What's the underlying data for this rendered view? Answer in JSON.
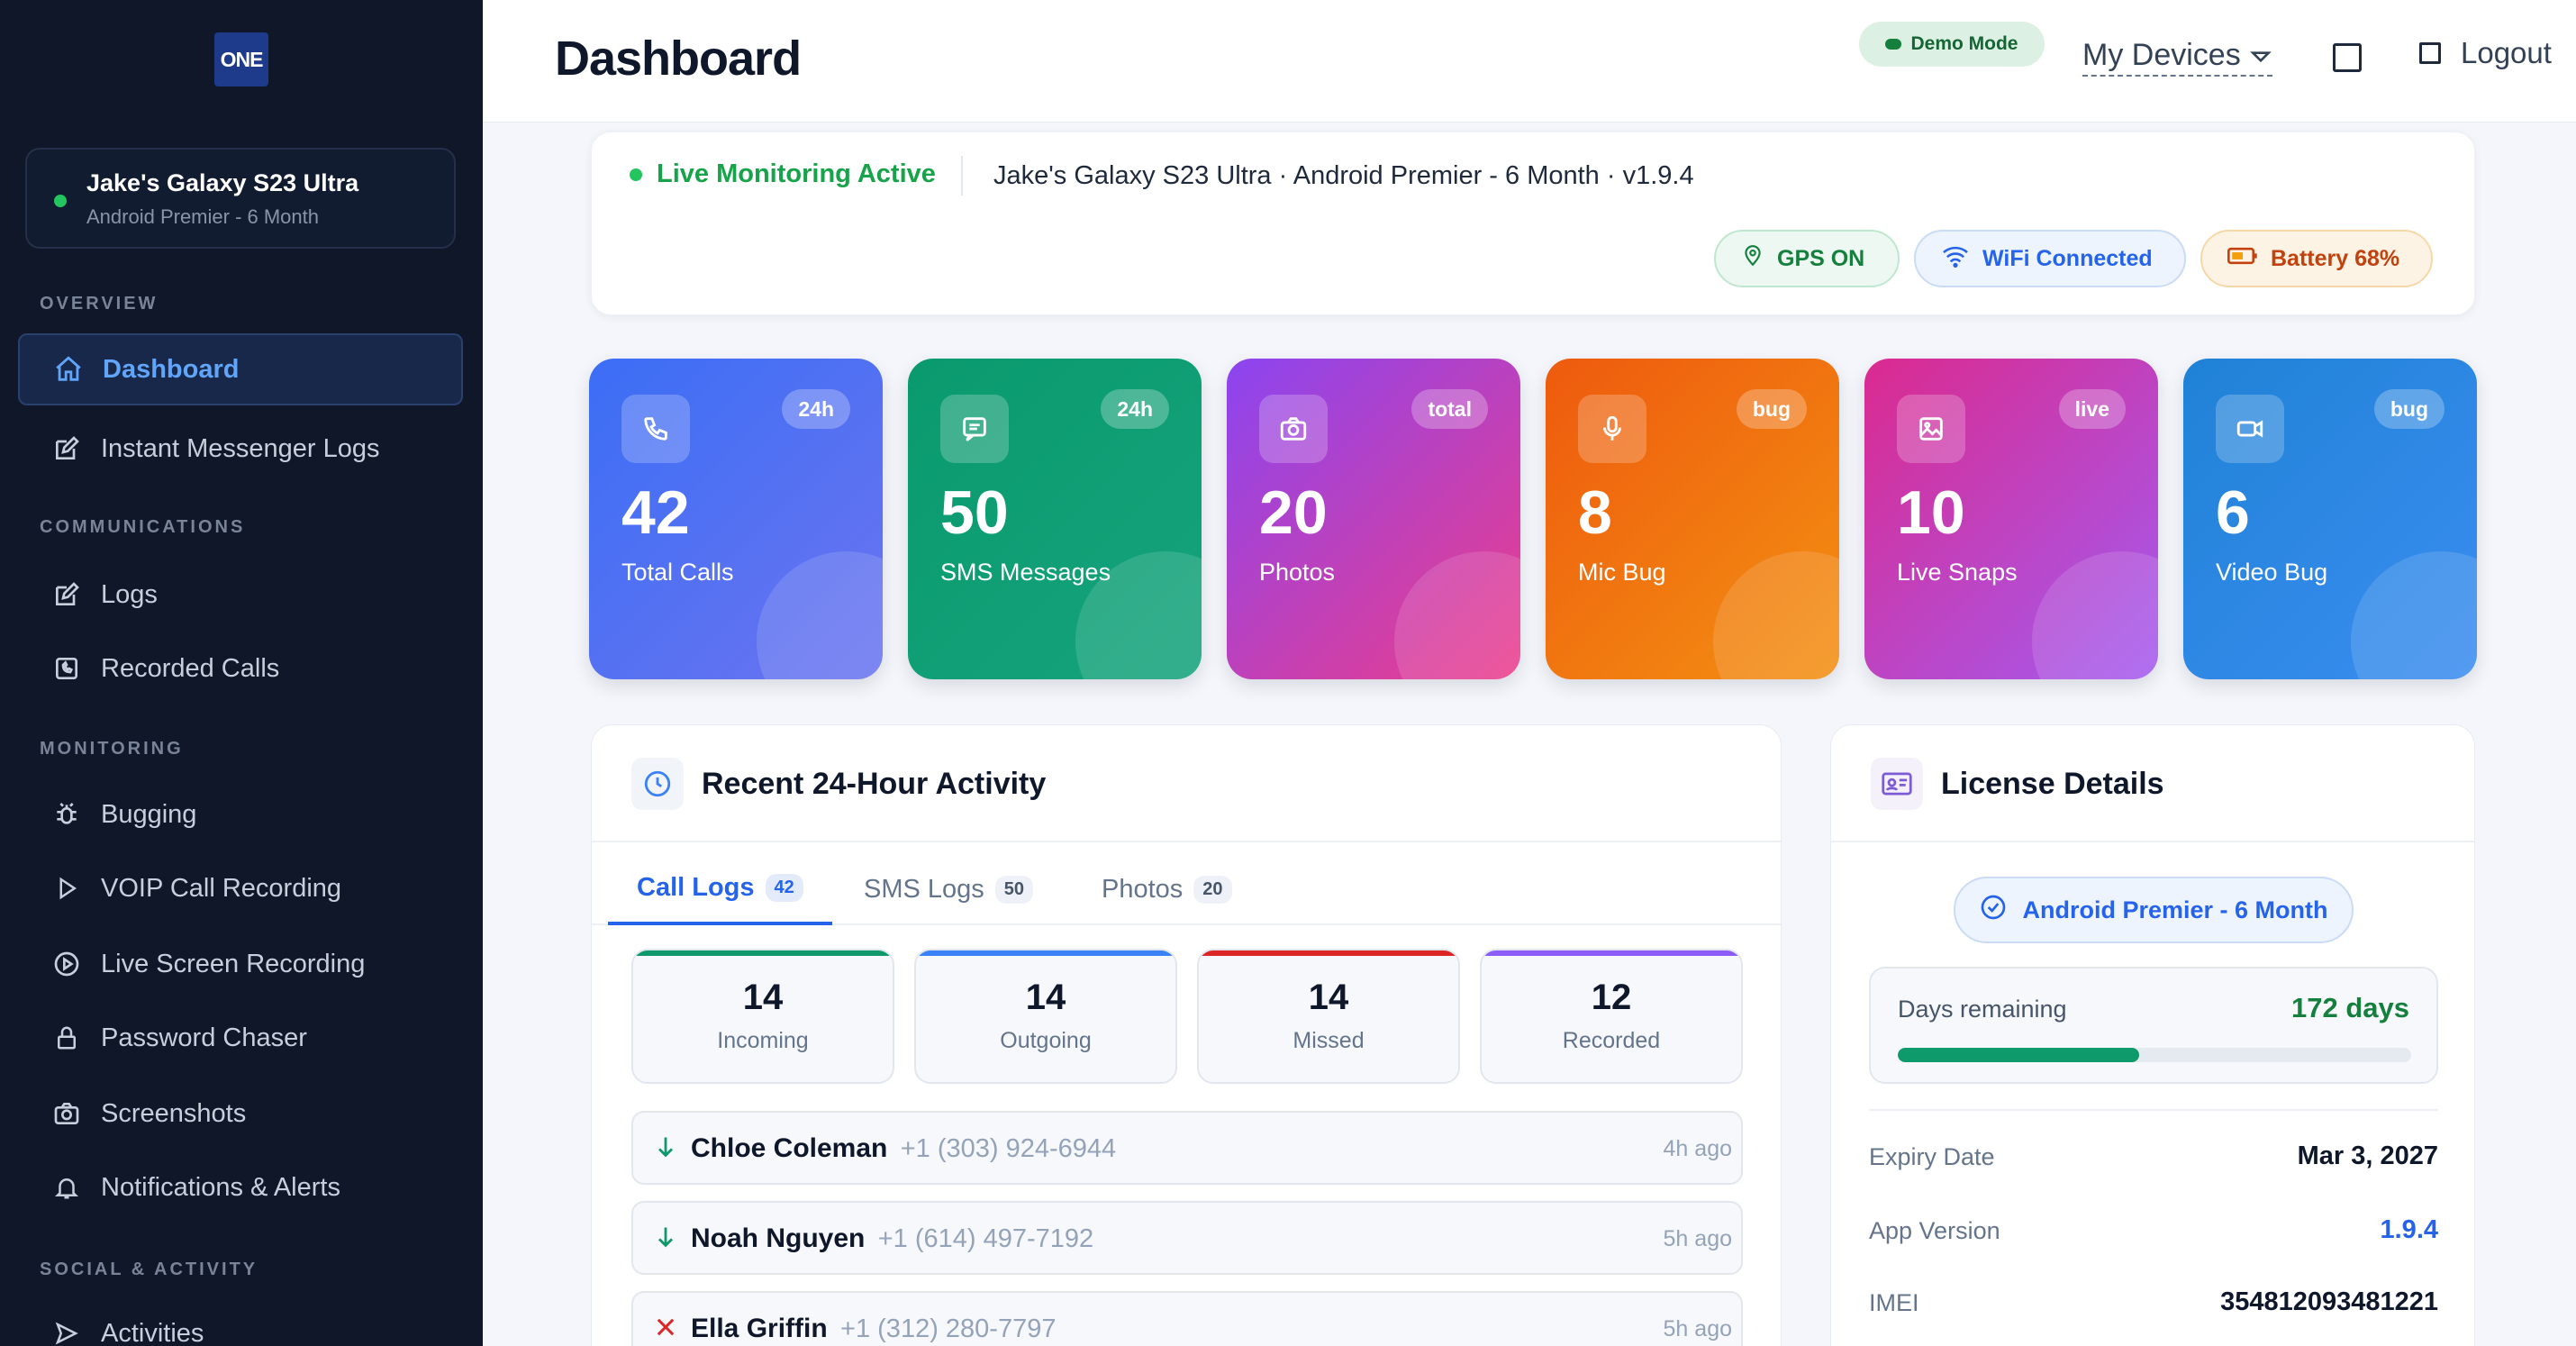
{
  "app": {
    "logo_text": "ONE"
  },
  "sidebar": {
    "device": {
      "name": "Jake's Galaxy S23 Ultra",
      "plan": "Android Premier - 6 Month",
      "status_color": "#22c55e"
    },
    "sections": {
      "overview": "OVERVIEW",
      "communications": "COMMUNICATIONS",
      "monitoring": "MONITORING",
      "social": "SOCIAL & ACTIVITY"
    },
    "items": [
      {
        "label": "Dashboard",
        "icon": "home-icon",
        "active": true
      },
      {
        "label": "Instant Messenger Logs",
        "icon": "edit-icon"
      },
      {
        "label": "Logs",
        "icon": "edit-icon"
      },
      {
        "label": "Recorded Calls",
        "icon": "phone-record-icon"
      },
      {
        "label": "Bugging",
        "icon": "bug-icon"
      },
      {
        "label": "VOIP Call Recording",
        "icon": "play-icon"
      },
      {
        "label": "Live Screen Recording",
        "icon": "play-circle-icon"
      },
      {
        "label": "Password Chaser",
        "icon": "lock-icon"
      },
      {
        "label": "Screenshots",
        "icon": "camera-icon"
      },
      {
        "label": "Notifications & Alerts",
        "icon": "bell-icon"
      },
      {
        "label": "Activities",
        "icon": "send-icon"
      }
    ]
  },
  "header": {
    "title": "Dashboard",
    "demo_label": "Demo Mode",
    "devices_label": "My Devices",
    "logout_label": "Logout"
  },
  "status": {
    "live_label": "Live Monitoring Active",
    "device_info": "Jake's Galaxy S23 Ultra · Android Premier - 6 Month · v1.9.4",
    "gps": "GPS ON",
    "wifi": "WiFi Connected",
    "battery": "Battery 68%"
  },
  "stats": [
    {
      "value": "42",
      "label": "Total Calls",
      "badge": "24h",
      "icon": "phone-icon",
      "colors": [
        "#3b6ef5",
        "#6b74f0"
      ]
    },
    {
      "value": "50",
      "label": "SMS Messages",
      "badge": "24h",
      "icon": "message-icon",
      "colors": [
        "#0a9a6e",
        "#15a37c"
      ]
    },
    {
      "value": "20",
      "label": "Photos",
      "badge": "total",
      "icon": "camera-icon",
      "colors": [
        "#8b45f0",
        "#ec3d8a"
      ]
    },
    {
      "value": "8",
      "label": "Mic Bug",
      "badge": "bug",
      "icon": "microphone-icon",
      "colors": [
        "#ee5a0e",
        "#f39012"
      ]
    },
    {
      "value": "10",
      "label": "Live Snaps",
      "badge": "live",
      "icon": "image-icon",
      "colors": [
        "#db2a8f",
        "#a35bf0"
      ]
    },
    {
      "value": "6",
      "label": "Video Bug",
      "badge": "bug",
      "icon": "video-icon",
      "colors": [
        "#1f82d6",
        "#3b8df0"
      ]
    }
  ],
  "activity": {
    "title": "Recent 24-Hour Activity",
    "tabs": [
      {
        "label": "Call Logs",
        "count": "42"
      },
      {
        "label": "SMS Logs",
        "count": "50"
      },
      {
        "label": "Photos",
        "count": "20"
      }
    ],
    "summary": [
      {
        "value": "14",
        "label": "Incoming",
        "color": "#10976a"
      },
      {
        "value": "14",
        "label": "Outgoing",
        "color": "#3b82f6"
      },
      {
        "value": "14",
        "label": "Missed",
        "color": "#dc2626"
      },
      {
        "value": "12",
        "label": "Recorded",
        "color": "#8b5cf6"
      }
    ],
    "calls": [
      {
        "name": "Chloe Coleman",
        "number": "+1 (303) 924-6944",
        "ago": "4h ago",
        "direction": "incoming"
      },
      {
        "name": "Noah Nguyen",
        "number": "+1 (614) 497-7192",
        "ago": "5h ago",
        "direction": "incoming"
      },
      {
        "name": "Ella Griffin",
        "number": "+1 (312) 280-7797",
        "ago": "5h ago",
        "direction": "missed"
      }
    ]
  },
  "license": {
    "title": "License Details",
    "plan": "Android Premier - 6 Month",
    "days_label": "Days remaining",
    "days_value": "172 days",
    "days_progress": 0.47,
    "rows": [
      {
        "key": "Expiry Date",
        "value": "Mar 3, 2027"
      },
      {
        "key": "App Version",
        "value": "1.9.4"
      },
      {
        "key": "IMEI",
        "value": "354812093481221"
      }
    ]
  }
}
